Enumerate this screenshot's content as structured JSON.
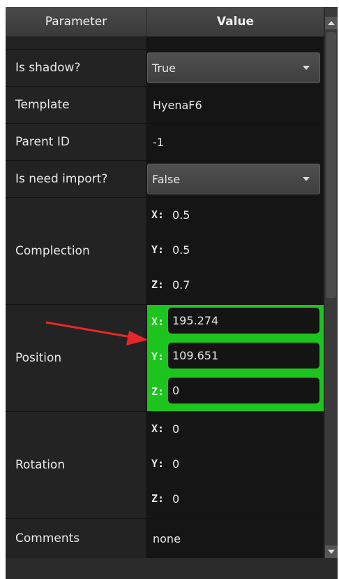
{
  "header": {
    "param": "Parameter",
    "value": "Value"
  },
  "rows": {
    "is_shadow": {
      "label": "Is shadow?",
      "value": "True"
    },
    "template": {
      "label": "Template",
      "value": "HyenaF6"
    },
    "parent_id": {
      "label": "Parent ID",
      "value": "-1"
    },
    "is_need_import": {
      "label": "Is need import?",
      "value": "False"
    },
    "complection": {
      "label": "Complection",
      "x_label": "X:",
      "x": "0.5",
      "y_label": "Y:",
      "y": "0.5",
      "z_label": "Z:",
      "z": "0.7"
    },
    "position": {
      "label": "Position",
      "x_label": "X:",
      "x": "195.274",
      "y_label": "Y:",
      "y": "109.651",
      "z_label": "Z:",
      "z": "0"
    },
    "rotation": {
      "label": "Rotation",
      "x_label": "X:",
      "x": "0",
      "y_label": "Y:",
      "y": "0",
      "z_label": "Z:",
      "z": "0"
    },
    "comments": {
      "label": "Comments",
      "value": "none"
    }
  },
  "colors": {
    "highlight": "#1ec41e",
    "annotation_arrow": "#e8262a"
  },
  "icons": {
    "combo_arrow": "chevron-down-icon",
    "scroll_up": "scroll-up-arrow-icon",
    "scroll_down": "scroll-down-arrow-icon"
  }
}
